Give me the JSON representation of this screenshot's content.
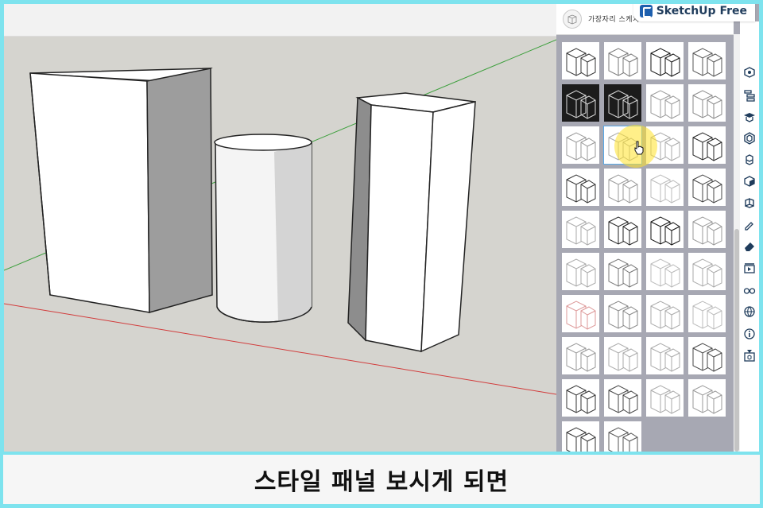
{
  "brand": {
    "badge_label": "SketchUp Free"
  },
  "styles_panel": {
    "title": "가장자리 스케치",
    "tile_count": 38,
    "dark_tiles": [
      4,
      5
    ],
    "selected_tile": 9
  },
  "toolbar": {
    "icons": [
      "entity-info-icon",
      "outliner-icon",
      "instructor-icon",
      "components-icon",
      "materials-icon",
      "layers-icon",
      "styles-icon",
      "scenes-icon",
      "eraser-icon",
      "animation-icon",
      "display-icon",
      "geolocation-icon",
      "info-icon",
      "3d-warehouse-icon"
    ],
    "active_icon": "styles-icon"
  },
  "caption": {
    "text": "스타일 패널 보시게 되면"
  },
  "colors": {
    "frame": "#7ee3ee",
    "panel_bg": "#a7a8b3",
    "highlight": "#ffe228",
    "axis_red": "#d23c3c",
    "axis_green": "#3c9f3c"
  }
}
